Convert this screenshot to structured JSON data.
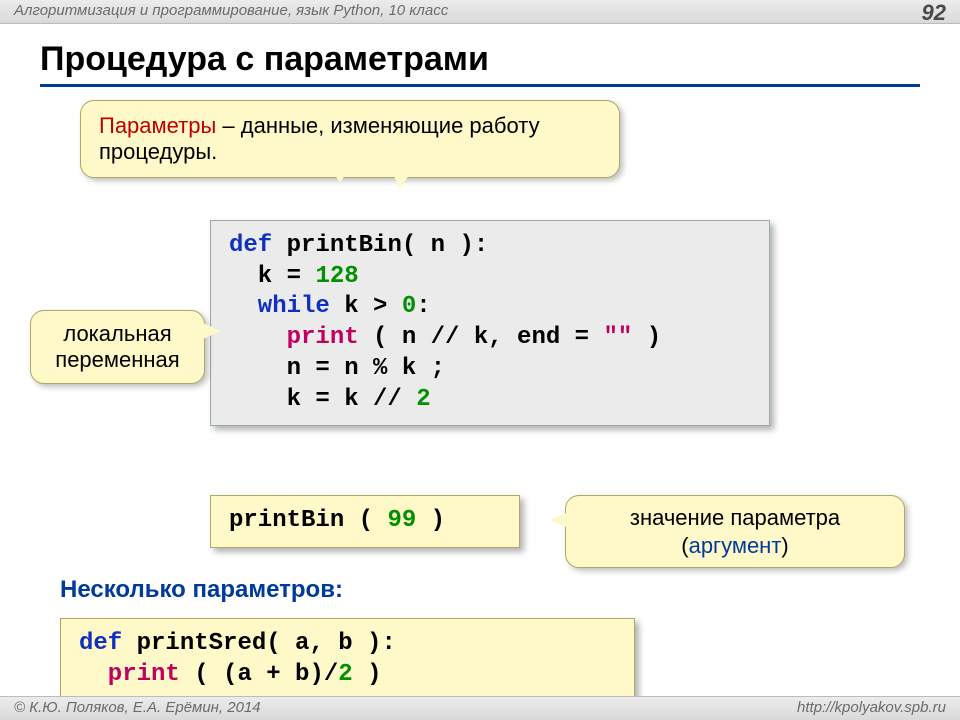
{
  "page": {
    "number": "92"
  },
  "header": {
    "course": "Алгоритмизация и программирование, язык Python, 10 класс"
  },
  "footer": {
    "authors": "© К.Ю. Поляков, Е.А. Ерёмин, 2014",
    "url": "http://kpolyakov.spb.ru"
  },
  "title": "Процедура с параметрами",
  "bubbles": {
    "params_hl": "Параметры",
    "params_rest": " – данные, изменяющие работу процедуры.",
    "localvar_l1": "локальная",
    "localvar_l2": "переменная",
    "argument_l1": "значение параметра",
    "argument_l2a": "(",
    "argument_l2b": "аргумент",
    "argument_l2c": ")"
  },
  "code_main": {
    "l1a": "def",
    "l1b": " printBin( n ):",
    "l2a": "  k",
    "l2b": " = ",
    "l2c": "128",
    "l3a": "  while",
    "l3b": " k",
    "l3c": " > ",
    "l3d": "0",
    "l3e": ":",
    "l4a": "    print",
    "l4b": " ( n",
    "l4c": " // ",
    "l4d": "k, end",
    "l4e": " = ",
    "l4f": "\"\"",
    "l4g": " )",
    "l5": "    n = n % k ;",
    "l6a": "    k = k",
    "l6b": " // ",
    "l6c": "2"
  },
  "code_call": {
    "a": "printBin ( ",
    "b": "99",
    "c": " )"
  },
  "subheading": "Несколько параметров:",
  "code_sred": {
    "l1a": "def",
    "l1b": " printSred( a, b ):",
    "l2a": "  print",
    "l2b": " ( (a + b)",
    "l2c": "/",
    "l2d": "2",
    "l2e": " )"
  }
}
